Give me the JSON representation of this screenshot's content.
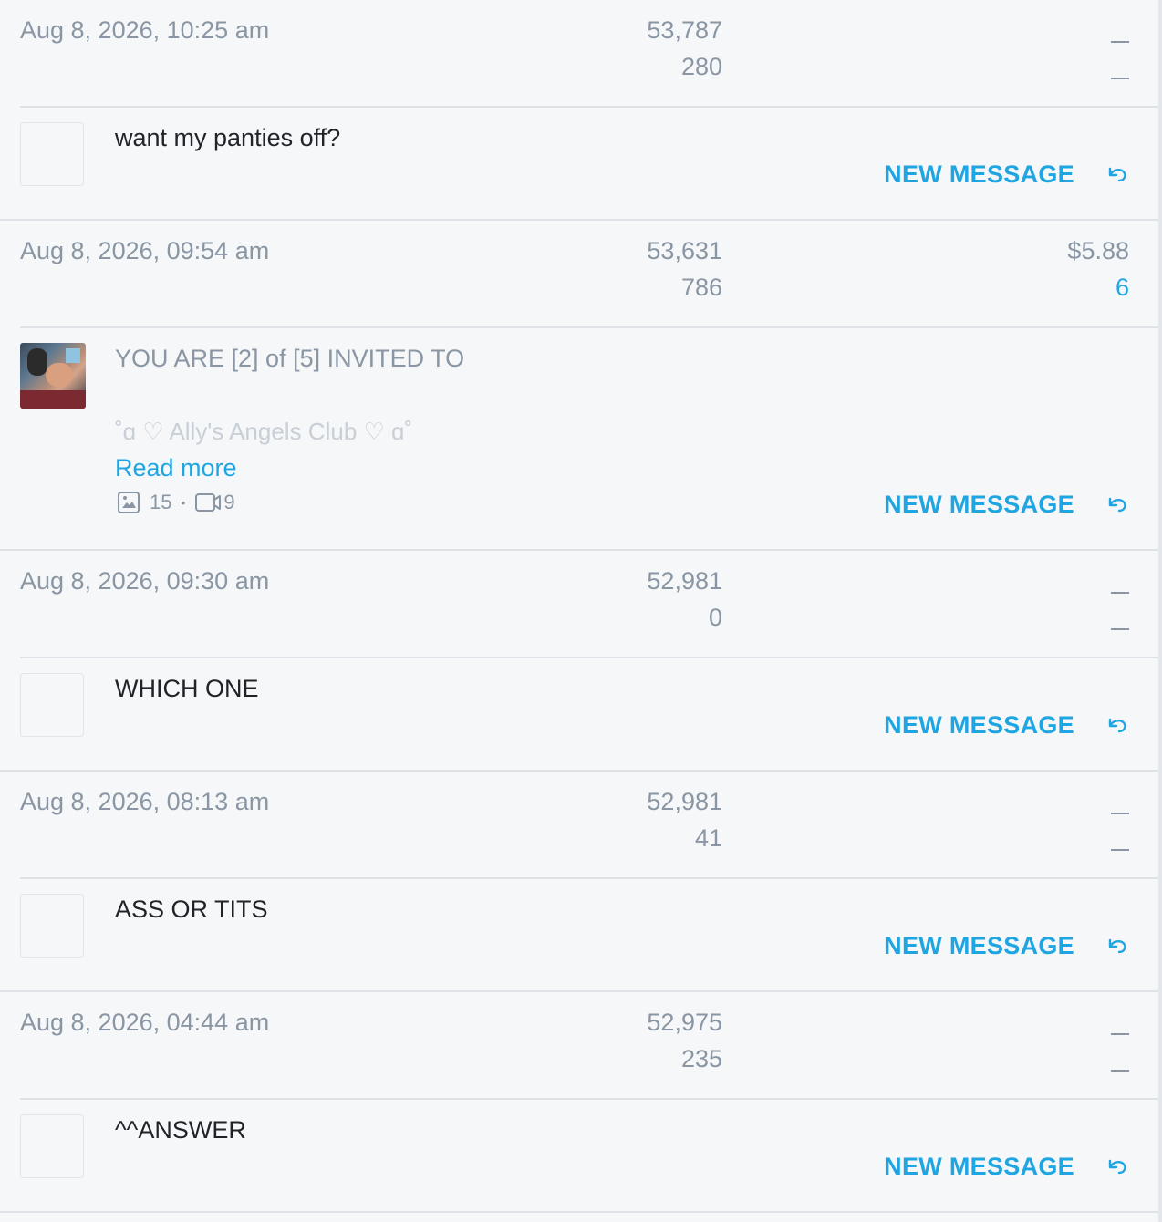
{
  "colors": {
    "accent": "#1fa6e2",
    "muted": "#8a96a3",
    "text": "#202429",
    "background": "#f5f7f9"
  },
  "messages": [
    {
      "date": "Aug 8, 2026, 10:25 am",
      "stat1": "53,787",
      "stat2": "280",
      "price": null,
      "price_count": null,
      "text": "want my panties off?",
      "has_image": false,
      "action_label": "NEW MESSAGE"
    },
    {
      "date": "Aug 8, 2026, 09:54 am",
      "stat1": "53,631",
      "stat2": "786",
      "price": "$5.88",
      "price_count": "6",
      "text": "YOU ARE [2] of [5] INVITED TO",
      "text_faded": "˚ɑ ♡ Ally's Angels Club ♡ ɑ˚",
      "read_more": "Read more",
      "photo_count": "15",
      "media_separator": "•",
      "video_count": "9",
      "has_image": true,
      "action_label": "NEW MESSAGE"
    },
    {
      "date": "Aug 8, 2026, 09:30 am",
      "stat1": "52,981",
      "stat2": "0",
      "price": null,
      "price_count": null,
      "text": "WHICH ONE",
      "has_image": false,
      "action_label": "NEW MESSAGE"
    },
    {
      "date": "Aug 8, 2026, 08:13 am",
      "stat1": "52,981",
      "stat2": "41",
      "price": null,
      "price_count": null,
      "text": "ASS OR TITS",
      "has_image": false,
      "action_label": "NEW MESSAGE"
    },
    {
      "date": "Aug 8, 2026, 04:44 am",
      "stat1": "52,975",
      "stat2": "235",
      "price": null,
      "price_count": null,
      "text": "^^ANSWER",
      "has_image": false,
      "action_label": "NEW MESSAGE"
    }
  ]
}
